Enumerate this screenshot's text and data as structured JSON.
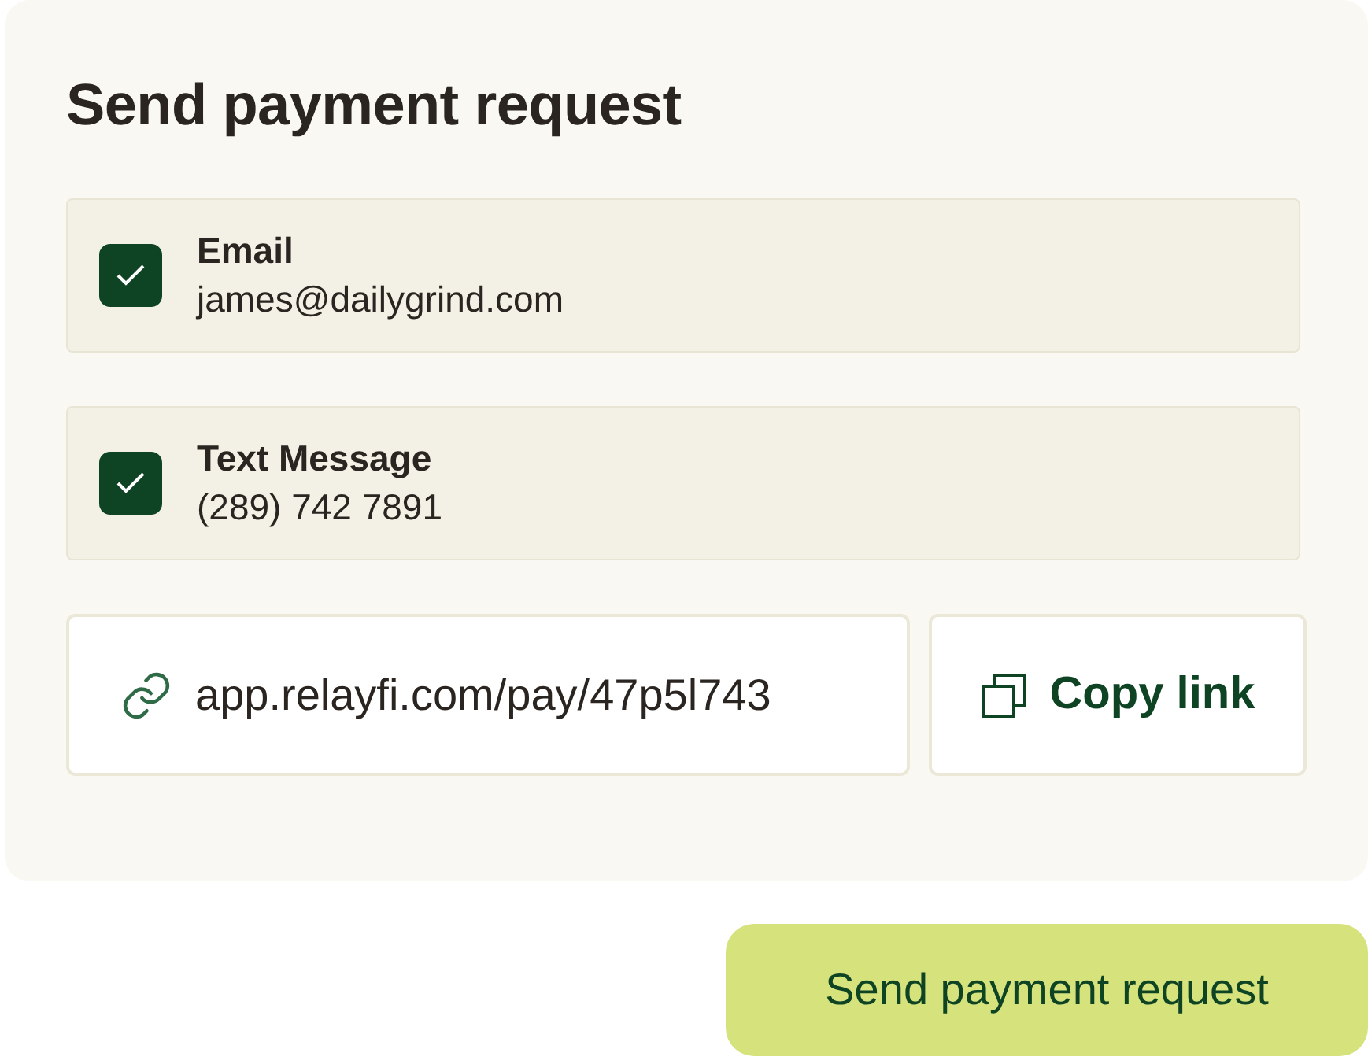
{
  "title": "Send payment request",
  "channels": [
    {
      "label": "Email",
      "value": "james@dailygrind.com",
      "checked": true
    },
    {
      "label": "Text Message",
      "value": "(289) 742 7891",
      "checked": true
    }
  ],
  "link": {
    "url": "app.relayfi.com/pay/47p5l743",
    "copy_label": "Copy link"
  },
  "submit": "Send payment request"
}
